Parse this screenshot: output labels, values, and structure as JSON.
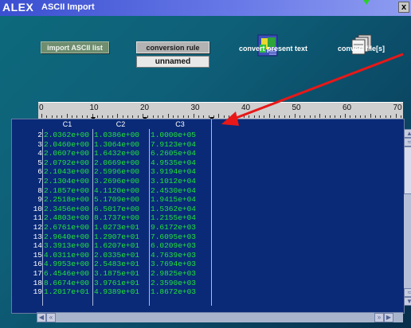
{
  "window": {
    "app": "ALEX",
    "title": "ASCII Import",
    "close_label": "x"
  },
  "toolbar": {
    "import_label": "import ASCII list",
    "rule_label": "conversion rule",
    "rule_name": "unnamed",
    "convert_present_label": "convert present text",
    "convert_files_label": "convert file[s]",
    "present_icon": "text-document-icon",
    "files_icon": "ascii-files-icon"
  },
  "ruler": {
    "labels": [
      "0",
      "10",
      "20",
      "30",
      "40",
      "50",
      "60",
      "70"
    ]
  },
  "table": {
    "headers": [
      "C1",
      "C2",
      "C3"
    ],
    "rows": [
      {
        "n": "2",
        "c1": "2.0362e+00",
        "c2": "1.0386e+00",
        "c3": "1.0000e+05"
      },
      {
        "n": "3",
        "c1": "2.0460e+00",
        "c2": "1.3064e+00",
        "c3": "7.9123e+04"
      },
      {
        "n": "4",
        "c1": "2.0607e+00",
        "c2": "1.6432e+00",
        "c3": "6.2605e+04"
      },
      {
        "n": "5",
        "c1": "2.0792e+00",
        "c2": "2.0669e+00",
        "c3": "4.9535e+04"
      },
      {
        "n": "6",
        "c1": "2.1043e+00",
        "c2": "2.5996e+00",
        "c3": "3.9194e+04"
      },
      {
        "n": "7",
        "c1": "2.1304e+00",
        "c2": "3.2696e+00",
        "c3": "3.1012e+04"
      },
      {
        "n": "8",
        "c1": "2.1857e+00",
        "c2": "4.1120e+00",
        "c3": "2.4530e+04"
      },
      {
        "n": "9",
        "c1": "2.2518e+00",
        "c2": "5.1709e+00",
        "c3": "1.9415e+04"
      },
      {
        "n": "10",
        "c1": "2.3456e+00",
        "c2": "6.5017e+00",
        "c3": "1.5362e+04"
      },
      {
        "n": "11",
        "c1": "2.4803e+00",
        "c2": "8.1737e+00",
        "c3": "1.2155e+04"
      },
      {
        "n": "12",
        "c1": "2.6761e+00",
        "c2": "1.0273e+01",
        "c3": "9.6172e+03"
      },
      {
        "n": "13",
        "c1": "2.9640e+00",
        "c2": "1.2907e+01",
        "c3": "7.6095e+03"
      },
      {
        "n": "14",
        "c1": "3.3913e+00",
        "c2": "1.6207e+01",
        "c3": "6.0209e+03"
      },
      {
        "n": "15",
        "c1": "4.0311e+00",
        "c2": "2.0335e+01",
        "c3": "4.7639e+03"
      },
      {
        "n": "16",
        "c1": "4.9953e+00",
        "c2": "2.5483e+01",
        "c3": "3.7694e+03"
      },
      {
        "n": "17",
        "c1": "6.4546e+00",
        "c2": "3.1875e+01",
        "c3": "2.9825e+03"
      },
      {
        "n": "18",
        "c1": "8.6674e+00",
        "c2": "3.9761e+01",
        "c3": "2.3590e+03"
      },
      {
        "n": "19",
        "c1": "1.2017e+01",
        "c2": "4.9389e+01",
        "c3": "1.8672e+03"
      }
    ]
  },
  "colors": {
    "cell_text": "#22e43a",
    "annotation_arrow": "#e81818",
    "table_bg": "#0a2a78"
  }
}
